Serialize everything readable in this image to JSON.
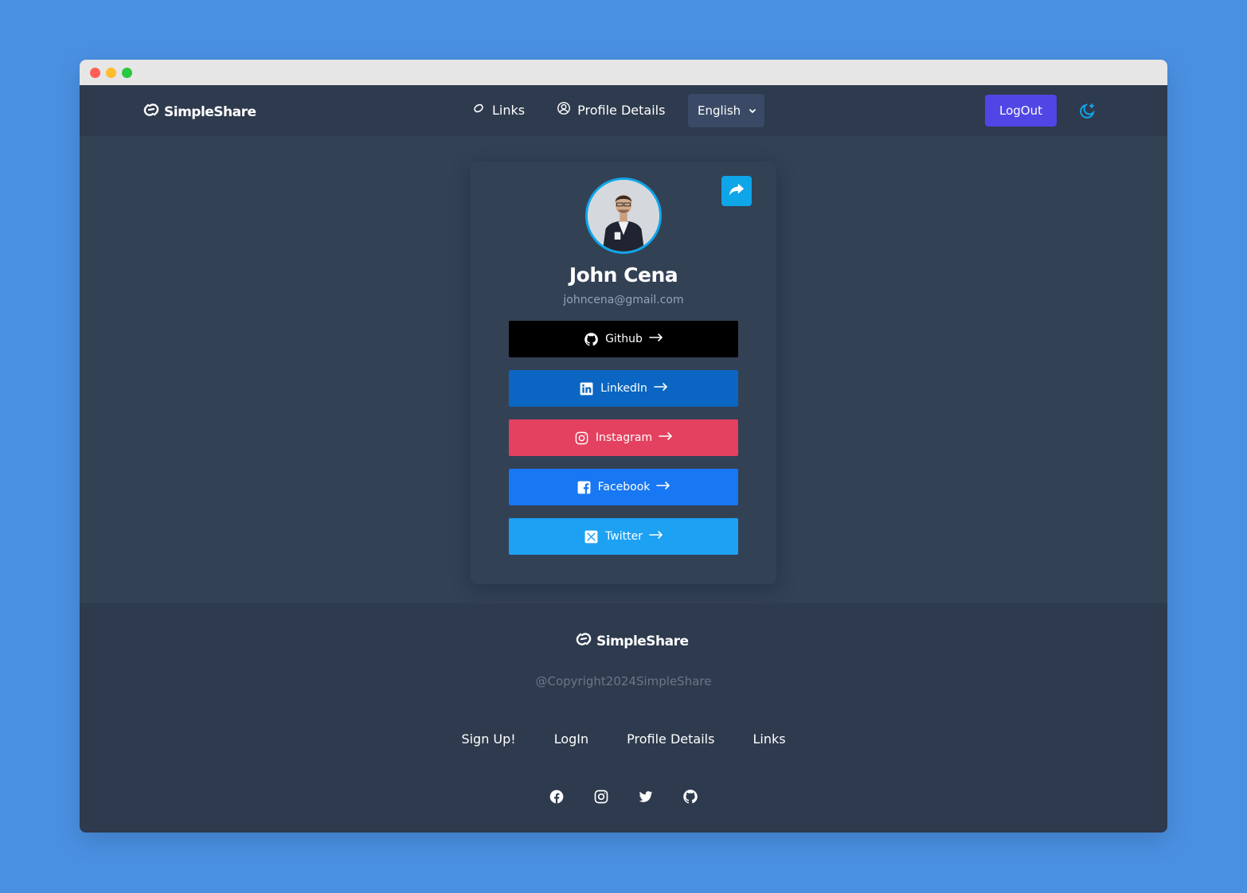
{
  "nav": {
    "brand": "SimpleShare",
    "links_label": "Links",
    "profile_label": "Profile Details",
    "language": "English",
    "logout_label": "LogOut"
  },
  "profile": {
    "name": "John Cena",
    "email": "johncena@gmail.com"
  },
  "links": [
    {
      "label": "Github",
      "icon": "github-icon",
      "color": "#000000"
    },
    {
      "label": "LinkedIn",
      "icon": "linkedin-icon",
      "color": "#0a66c2"
    },
    {
      "label": "Instagram",
      "icon": "instagram-icon",
      "color": "#e4405f"
    },
    {
      "label": "Facebook",
      "icon": "facebook-icon",
      "color": "#1877f2"
    },
    {
      "label": "Twitter",
      "icon": "x-icon",
      "color": "#1da1f2"
    }
  ],
  "footer": {
    "brand": "SimpleShare",
    "copyright": "@Copyright2024SimpleShare",
    "links": [
      "Sign Up!",
      "LogIn",
      "Profile Details",
      "Links"
    ],
    "social_icons": [
      "facebook-icon",
      "instagram-icon",
      "twitter-icon",
      "github-icon"
    ]
  },
  "colors": {
    "page_bg": "#4a90e2",
    "nav_bg": "#2e3a4d",
    "main_bg": "#334155",
    "accent": "#4f46e5",
    "share": "#0ea5e9"
  }
}
